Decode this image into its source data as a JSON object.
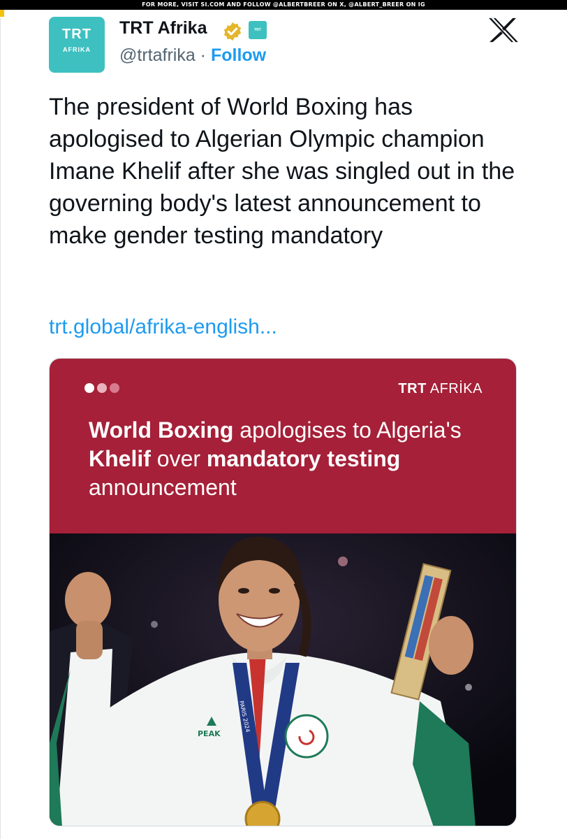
{
  "top_banner": "FOR MORE, VISIT SI.COM AND FOLLOW @ALBERTBREER ON X, @ALBERT_BREER ON IG",
  "account": {
    "avatar_line1": "TRT",
    "avatar_line2": "AFRIKA",
    "name": "TRT Afrika",
    "handle": "@trtafrika",
    "separator": " · ",
    "follow_label": "Follow",
    "verified_color": "#e5b62b",
    "affiliate_badge_text": "TRT WORLD"
  },
  "platform_icon": "x-logo-icon",
  "tweet": {
    "text": "The president of World Boxing has apologised to Algerian Olympic champion Imane Khelif after she was singled out in the governing body's latest announcement to make gender testing mandatory",
    "link": "trt.global/afrika-english..."
  },
  "card": {
    "brand_bold": "TRT",
    "brand_rest": " AFRİKA",
    "headline_parts": [
      {
        "text": "World Boxing",
        "bold": true
      },
      {
        "text": " apologises to Algeria's ",
        "bold": false
      },
      {
        "text": "Khelif",
        "bold": true
      },
      {
        "text": " over ",
        "bold": false
      },
      {
        "text": "mandatory testing",
        "bold": true
      },
      {
        "text": " announcement",
        "bold": false
      }
    ],
    "banner_color": "#a52038",
    "dot_colors": [
      "#ffffff",
      "#e9b3be",
      "#d77b8f"
    ],
    "photo_medal_text": "PARIS 2024",
    "photo_logo_text": "PEAK"
  },
  "colors": {
    "accent": "#1d9bf0",
    "text": "#0f1419",
    "muted": "#536471",
    "avatar_bg": "#3ec0c0"
  }
}
